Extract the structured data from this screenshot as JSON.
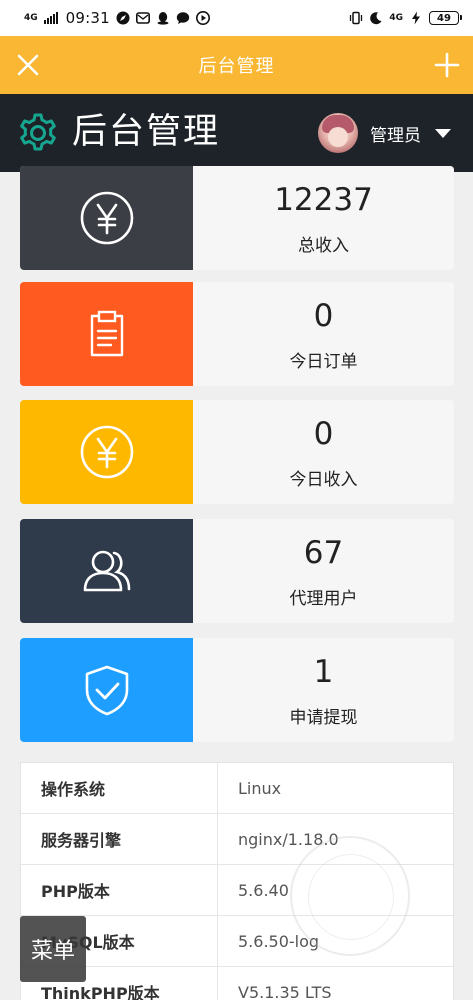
{
  "status_bar": {
    "network": "4G",
    "time": "09:31",
    "right_network": "4G",
    "battery": "49"
  },
  "title_bar": {
    "title": "后台管理",
    "close_icon": "close-icon",
    "add_icon": "plus-icon"
  },
  "admin_header": {
    "brand": "后台管理",
    "user_name": "管理员"
  },
  "cards": [
    {
      "value": "12237",
      "label": "总收入",
      "color": "#3b3e45",
      "icon": "yen-icon"
    },
    {
      "value": "0",
      "label": "今日订单",
      "color": "#ff5a1f",
      "icon": "clipboard-icon"
    },
    {
      "value": "0",
      "label": "今日收入",
      "color": "#ffb800",
      "icon": "yen-icon"
    },
    {
      "value": "67",
      "label": "代理用户",
      "color": "#2f3a4b",
      "icon": "users-icon"
    },
    {
      "value": "1",
      "label": "申请提现",
      "color": "#1e9fff",
      "icon": "shield-check-icon"
    }
  ],
  "system_info": [
    {
      "key": "操作系统",
      "value": "Linux"
    },
    {
      "key": "服务器引擎",
      "value": "nginx/1.18.0"
    },
    {
      "key": "PHP版本",
      "value": "5.6.40"
    },
    {
      "key": "MySQL版本",
      "value": "5.6.50-log"
    },
    {
      "key": "ThinkPHP版本",
      "value": "V5.1.35 LTS"
    }
  ],
  "menu_button": "菜单",
  "colors": {
    "title_bar": "#fab733",
    "header": "#1e2329",
    "accent_gear": "#17a68f"
  }
}
